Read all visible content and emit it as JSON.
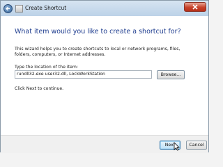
{
  "window": {
    "title": "Create Shortcut"
  },
  "wizard": {
    "heading": "What item would you like to create a shortcut for?",
    "description": "This wizard helps you to create shortcuts to local or network programs, files, folders, computers, or Internet addresses.",
    "location_label": "Type the location of the item:",
    "location_value": "rundll32.exe user32.dll, LockWorkStation",
    "browse_label": "Browse...",
    "hint": "Click Next to continue."
  },
  "footer": {
    "next_label": "Next",
    "cancel_label": "Cancel"
  },
  "colors": {
    "heading": "#1f3d8f",
    "close_button": "#c7422a",
    "next_button": "#bfe2f8"
  }
}
